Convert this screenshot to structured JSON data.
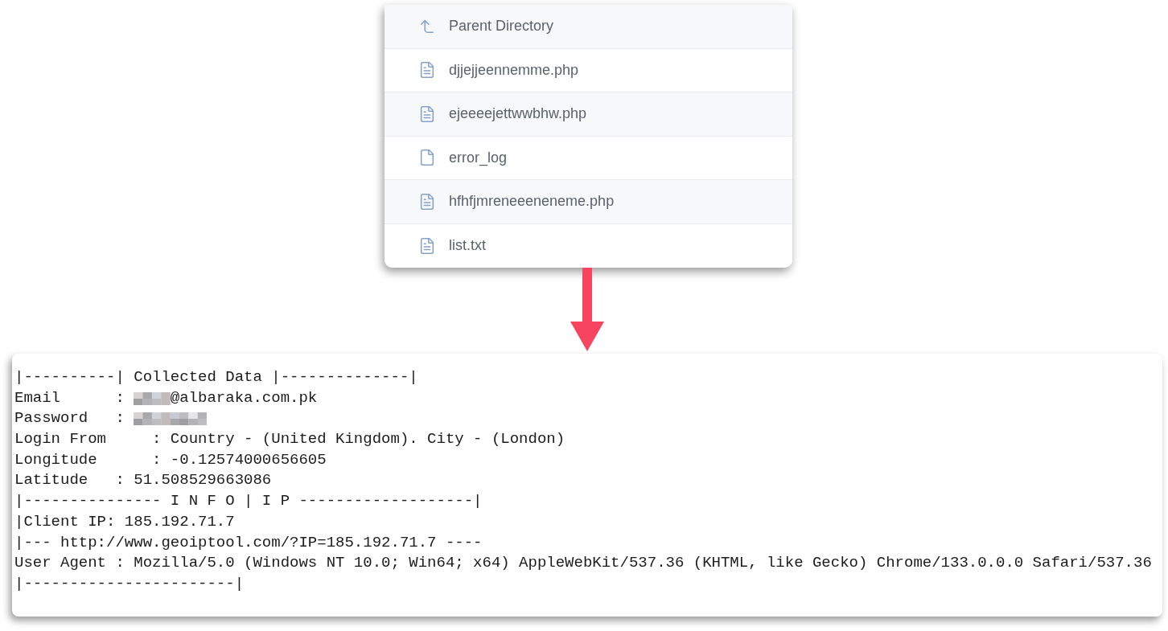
{
  "file_list": {
    "items": [
      {
        "name": "Parent Directory",
        "kind": "parent"
      },
      {
        "name": "djjejjeennemme.php",
        "kind": "text_file"
      },
      {
        "name": "ejeeeejettwwbhw.php",
        "kind": "text_file"
      },
      {
        "name": "error_log",
        "kind": "blank_file"
      },
      {
        "name": "hfhfjmreneeeneneme.php",
        "kind": "text_file"
      },
      {
        "name": "list.txt",
        "kind": "text_file"
      }
    ]
  },
  "log": {
    "lines": [
      {
        "kind": "plain",
        "text": "|----------| Collected Data |--------------|"
      },
      {
        "kind": "masked_prefix",
        "label": "Email      :",
        "value": "@albaraka.com.pk"
      },
      {
        "kind": "masked",
        "label": "Password   :"
      },
      {
        "kind": "plain",
        "text": "Login From     : Country - (United Kingdom). City - (London)"
      },
      {
        "kind": "plain",
        "text": "Longitude      : -0.12574000656605"
      },
      {
        "kind": "plain",
        "text": "Latitude   : 51.508529663086"
      },
      {
        "kind": "plain",
        "text": "|--------------- I N F O | I P -------------------|"
      },
      {
        "kind": "plain",
        "text": "|Client IP: 185.192.71.7"
      },
      {
        "kind": "plain",
        "text": "|--- http://www.geoiptool.com/?IP=185.192.71.7 ----"
      },
      {
        "kind": "plain",
        "text": "User Agent : Mozilla/5.0 (Windows NT 10.0; Win64; x64) AppleWebKit/537.36 (KHTML, like Gecko) Chrome/133.0.0.0 Safari/537.36"
      },
      {
        "kind": "plain",
        "text": "|-----------------------|"
      }
    ]
  }
}
